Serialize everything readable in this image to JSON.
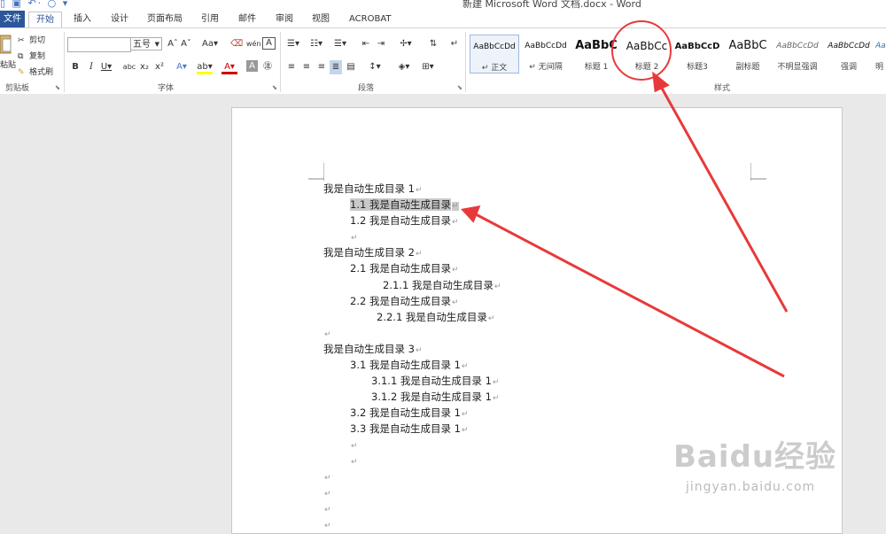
{
  "window": {
    "title": "新建 Microsoft Word 文档.docx - Word"
  },
  "tabs": [
    "文件",
    "开始",
    "插入",
    "设计",
    "页面布局",
    "引用",
    "邮件",
    "审阅",
    "视图",
    "ACROBAT"
  ],
  "clipboard": {
    "paste": "粘贴",
    "cut": "剪切",
    "copy": "复制",
    "format_painter": "格式刷",
    "group": "剪贴板"
  },
  "font": {
    "size": "五号",
    "group": "字体"
  },
  "paragraph": {
    "group": "段落"
  },
  "styles": {
    "group": "样式",
    "items": [
      {
        "preview": "AaBbCcDd",
        "name": "↵ 正文"
      },
      {
        "preview": "AaBbCcDd",
        "name": "↵ 无间隔"
      },
      {
        "preview": "AaBbC",
        "name": "标题 1"
      },
      {
        "preview": "AaBbCc",
        "name": "标题 2"
      },
      {
        "preview": "AaBbCcD",
        "name": "标题3"
      },
      {
        "preview": "AaBbC",
        "name": "副标题"
      },
      {
        "preview": "AaBbCcDd",
        "name": "不明显强调"
      },
      {
        "preview": "AaBbCcDd",
        "name": "强调"
      },
      {
        "preview": "AaBbCcDd",
        "name": "明"
      }
    ]
  },
  "document": {
    "lines": [
      "我是自动生成目录 1",
      "1.1 我是自动生成目录",
      "1.2 我是自动生成目录",
      "",
      "我是自动生成目录 2",
      "2.1 我是自动生成目录",
      "2.1.1 我是自动生成目录",
      "2.2 我是自动生成目录",
      "2.2.1 我是自动生成目录",
      "",
      "我是自动生成目录 3",
      "3.1 我是自动生成目录 1",
      "3.1.1 我是自动生成目录 1",
      "3.1.2 我是自动生成目录 1",
      "3.2 我是自动生成目录 1",
      "3.3 我是自动生成目录 1"
    ],
    "paragraph_mark": "↵"
  },
  "watermark": {
    "main": "Baidu经验",
    "sub": "jingyan.baidu.com"
  },
  "colors": {
    "accent": "#2b579a",
    "annotation": "#e8393a"
  }
}
